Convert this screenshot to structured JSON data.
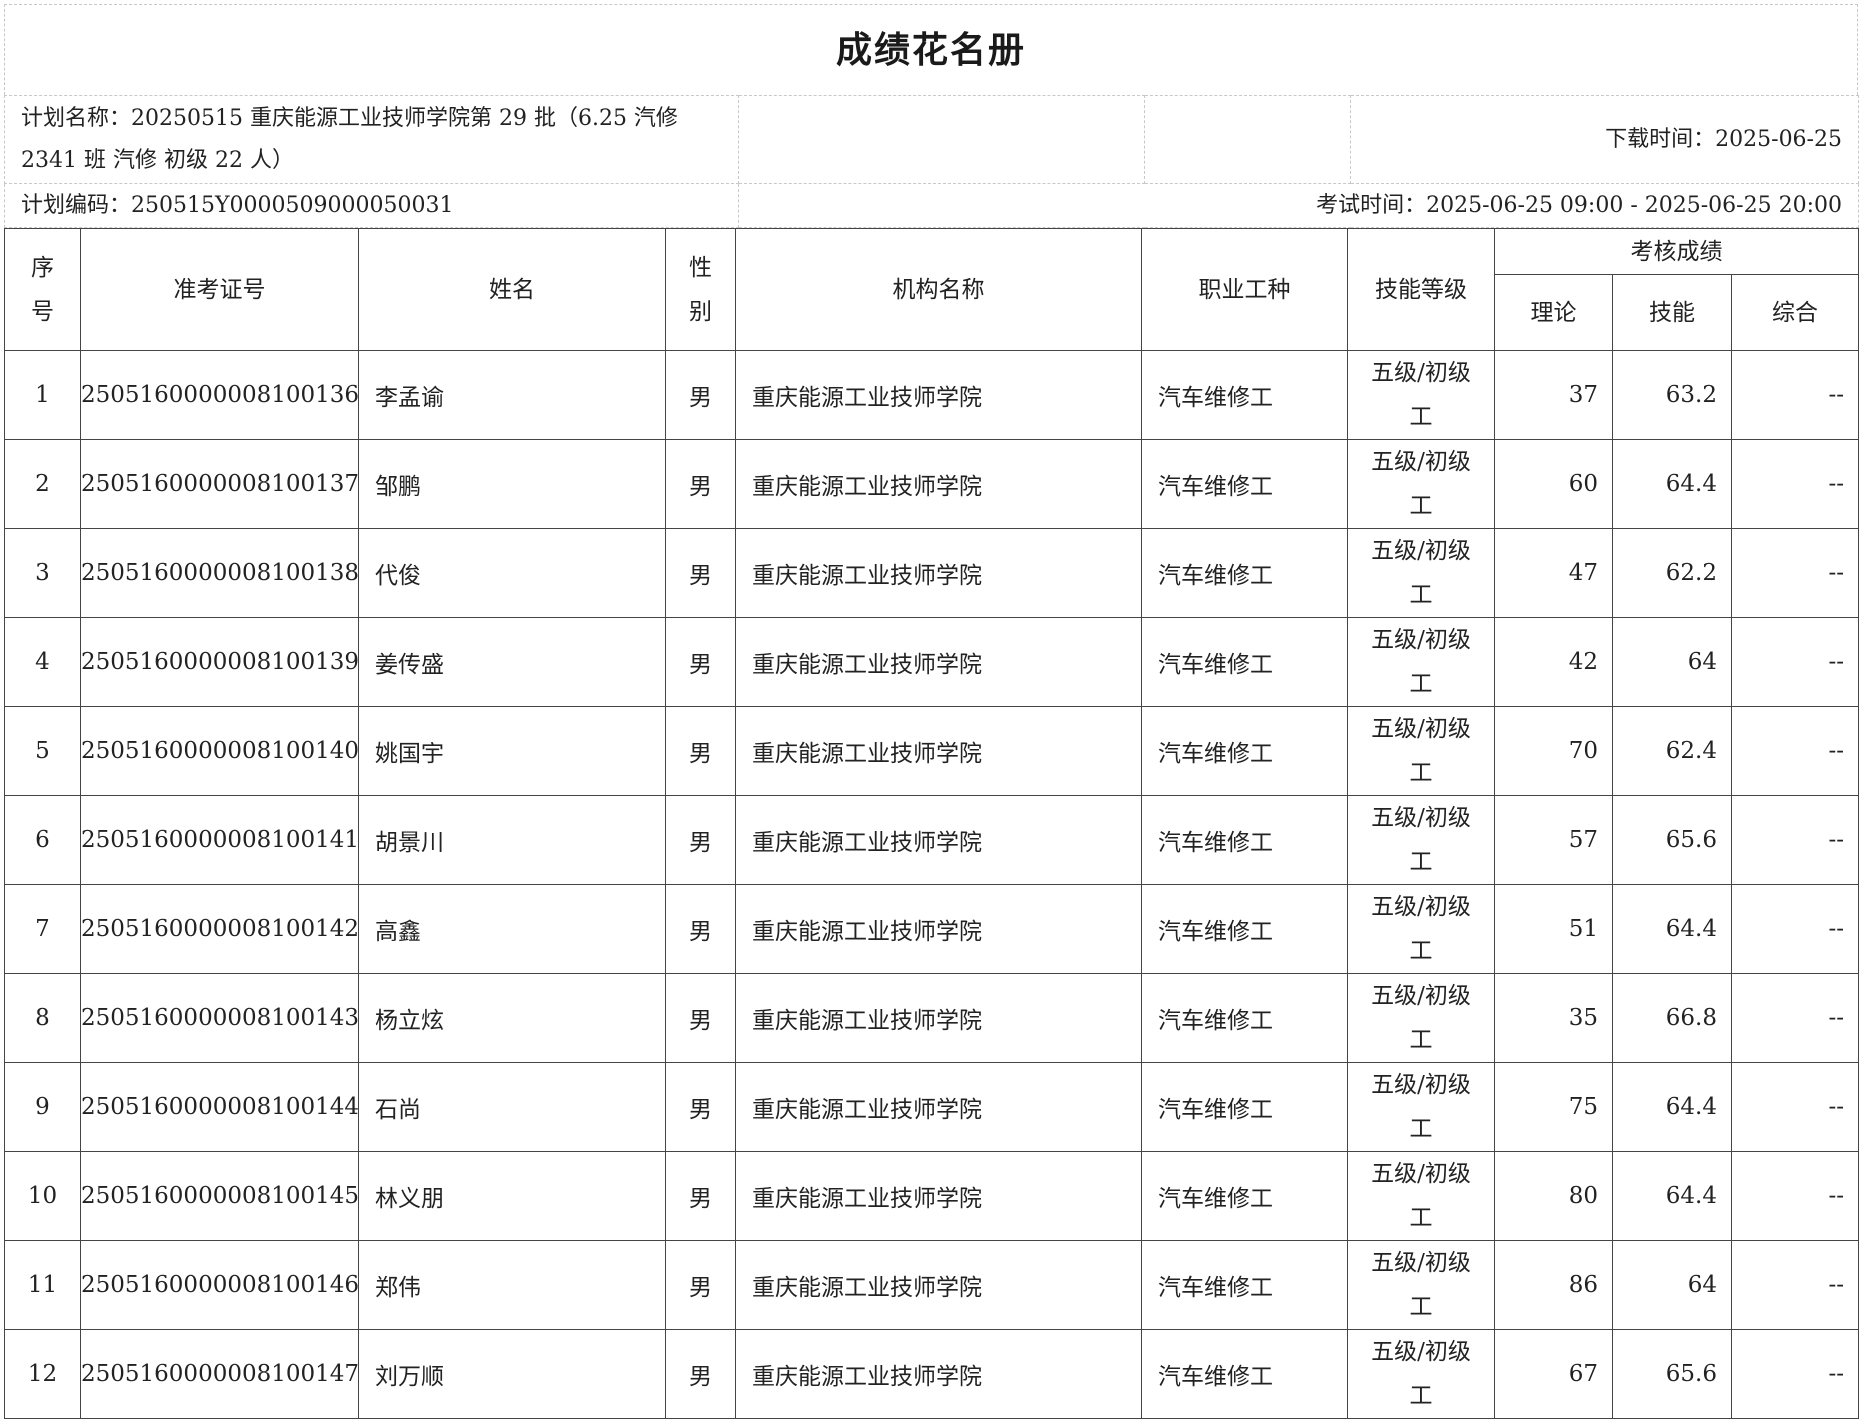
{
  "title": "成绩花名册",
  "info": {
    "plan_name": "计划名称：20250515 重庆能源工业技师学院第 29 批（6.25 汽修 2341 班 汽修 初级 22 人）",
    "download_time": "下载时间：2025-06-25",
    "plan_code": "计划编码：250515Y0000509000050031",
    "exam_time": "考试时间：2025-06-25 09:00 - 2025-06-25 20:00"
  },
  "headers": {
    "seq": "序号",
    "ticket": "准考证号",
    "name": "姓名",
    "gender": "性别",
    "org": "机构名称",
    "job": "职业工种",
    "level": "技能等级",
    "score_group": "考核成绩",
    "theory": "理论",
    "skill": "技能",
    "overall": "综合"
  },
  "rows": [
    {
      "seq": "1",
      "ticket": "2505160000008100136",
      "name": "李孟谕",
      "gender": "男",
      "org": "重庆能源工业技师学院",
      "job": "汽车维修工",
      "level": "五级/初级工",
      "theory": "37",
      "skill": "63.2",
      "overall": "--"
    },
    {
      "seq": "2",
      "ticket": "2505160000008100137",
      "name": "邹鹏",
      "gender": "男",
      "org": "重庆能源工业技师学院",
      "job": "汽车维修工",
      "level": "五级/初级工",
      "theory": "60",
      "skill": "64.4",
      "overall": "--"
    },
    {
      "seq": "3",
      "ticket": "2505160000008100138",
      "name": "代俊",
      "gender": "男",
      "org": "重庆能源工业技师学院",
      "job": "汽车维修工",
      "level": "五级/初级工",
      "theory": "47",
      "skill": "62.2",
      "overall": "--"
    },
    {
      "seq": "4",
      "ticket": "2505160000008100139",
      "name": "姜传盛",
      "gender": "男",
      "org": "重庆能源工业技师学院",
      "job": "汽车维修工",
      "level": "五级/初级工",
      "theory": "42",
      "skill": "64",
      "overall": "--"
    },
    {
      "seq": "5",
      "ticket": "2505160000008100140",
      "name": "姚国宇",
      "gender": "男",
      "org": "重庆能源工业技师学院",
      "job": "汽车维修工",
      "level": "五级/初级工",
      "theory": "70",
      "skill": "62.4",
      "overall": "--"
    },
    {
      "seq": "6",
      "ticket": "2505160000008100141",
      "name": "胡景川",
      "gender": "男",
      "org": "重庆能源工业技师学院",
      "job": "汽车维修工",
      "level": "五级/初级工",
      "theory": "57",
      "skill": "65.6",
      "overall": "--"
    },
    {
      "seq": "7",
      "ticket": "2505160000008100142",
      "name": "高鑫",
      "gender": "男",
      "org": "重庆能源工业技师学院",
      "job": "汽车维修工",
      "level": "五级/初级工",
      "theory": "51",
      "skill": "64.4",
      "overall": "--"
    },
    {
      "seq": "8",
      "ticket": "2505160000008100143",
      "name": "杨立炫",
      "gender": "男",
      "org": "重庆能源工业技师学院",
      "job": "汽车维修工",
      "level": "五级/初级工",
      "theory": "35",
      "skill": "66.8",
      "overall": "--"
    },
    {
      "seq": "9",
      "ticket": "2505160000008100144",
      "name": "石尚",
      "gender": "男",
      "org": "重庆能源工业技师学院",
      "job": "汽车维修工",
      "level": "五级/初级工",
      "theory": "75",
      "skill": "64.4",
      "overall": "--"
    },
    {
      "seq": "10",
      "ticket": "2505160000008100145",
      "name": "林义朋",
      "gender": "男",
      "org": "重庆能源工业技师学院",
      "job": "汽车维修工",
      "level": "五级/初级工",
      "theory": "80",
      "skill": "64.4",
      "overall": "--"
    },
    {
      "seq": "11",
      "ticket": "2505160000008100146",
      "name": "郑伟",
      "gender": "男",
      "org": "重庆能源工业技师学院",
      "job": "汽车维修工",
      "level": "五级/初级工",
      "theory": "86",
      "skill": "64",
      "overall": "--"
    },
    {
      "seq": "12",
      "ticket": "2505160000008100147",
      "name": "刘万顺",
      "gender": "男",
      "org": "重庆能源工业技师学院",
      "job": "汽车维修工",
      "level": "五级/初级工",
      "theory": "67",
      "skill": "65.6",
      "overall": "--"
    }
  ]
}
